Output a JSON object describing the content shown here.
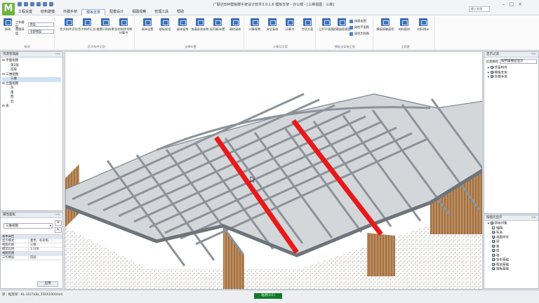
{
  "window": {
    "title": "广联达BIM模板脚手架设计软件3.0.1.6 模板支架 - 办公楼 - [三维视图：三维]",
    "search_box": "键入关键"
  },
  "ribbon_tabs": [
    {
      "label": "工程设置",
      "active": false
    },
    {
      "label": "结构建模",
      "active": false
    },
    {
      "label": "外脚手架",
      "active": false
    },
    {
      "label": "模板支架",
      "active": true
    },
    {
      "label": "配模设计",
      "active": false
    },
    {
      "label": "视图观察",
      "active": false
    },
    {
      "label": "管理工具",
      "active": false
    },
    {
      "label": "帮助",
      "active": false
    }
  ],
  "ribbon": {
    "select_group": {
      "select_label": "修改",
      "work_floor_label": "工作楼层",
      "work_floor_value": "首层",
      "view_depth_label": "视图深度",
      "view_depth_value": "全部楼层",
      "group_label": "修改"
    },
    "identify_group": {
      "buttons": [
        "危大构件识别",
        "危大构件汇总",
        "重置识别结果",
        "危险构件判断计算书"
      ],
      "group_label": "危大构件识别"
    },
    "layout_group": {
      "buttons": [
        "梁体设置",
        "楼板架设",
        "梁体架构",
        "查看梁体参数",
        "配切板布置",
        "清除梁体"
      ],
      "group_label": "支模布置"
    },
    "calc_group": {
      "buttons": [
        "计算参数",
        "安全复核",
        "计算书",
        "专项方案"
      ],
      "group_label": "计算及方案"
    },
    "drawing_group": {
      "buttons": [
        "立杆平面图",
        "创建剖面视图"
      ],
      "small": [
        "剖面出图",
        "梁柱平面图",
        "梁柱大样图"
      ],
      "group_label": "模板支架施工图"
    },
    "material_group": {
      "buttons": [
        "模板接触面积",
        "材料配料",
        "材料统计"
      ],
      "group_label": "工程量"
    }
  },
  "resource_panel": {
    "title": "资源管理器",
    "tree": [
      {
        "label": "平面视图",
        "indent": 0,
        "checked": true,
        "selected": false
      },
      {
        "label": "第2层",
        "indent": 2,
        "checked": false,
        "selected": false
      },
      {
        "label": "首层",
        "indent": 2,
        "checked": false,
        "selected": false
      },
      {
        "label": "三维视图",
        "indent": 0,
        "checked": true,
        "selected": false
      },
      {
        "label": "三维",
        "indent": 2,
        "checked": false,
        "selected": true
      },
      {
        "label": "立面视图",
        "indent": 0,
        "checked": true,
        "selected": false
      },
      {
        "label": "东",
        "indent": 2,
        "checked": false,
        "selected": false
      },
      {
        "label": "南",
        "indent": 2,
        "checked": false,
        "selected": false
      },
      {
        "label": "西",
        "indent": 2,
        "checked": false,
        "selected": false
      },
      {
        "label": "北",
        "indent": 2,
        "checked": false,
        "selected": false
      },
      {
        "label": "表",
        "indent": 0,
        "checked": true,
        "selected": false
      }
    ]
  },
  "properties_panel": {
    "title": "属性面板",
    "type_value": "三维视图",
    "sections": [
      {
        "header": "基本属性",
        "rows": [
          {
            "k": "显示模式",
            "v": "着色、有光照、..."
          },
          {
            "k": "视图名称",
            "v": "三维"
          },
          {
            "k": "模型比例",
            "v": "1:100"
          }
        ]
      },
      {
        "header": "视图范围",
        "rows": [
          {
            "k": "工作楼层",
            "v": "首层"
          }
        ]
      }
    ],
    "apply_button": "应用"
  },
  "display_filter_panel": {
    "title": "显示过滤",
    "rule_label": "过滤规则",
    "rule_value": "按所属楼层显示",
    "items": [
      {
        "label": "项目构件",
        "checked": true
      },
      {
        "label": "模板支架",
        "checked": true
      },
      {
        "label": "外脚手架",
        "checked": true
      }
    ]
  },
  "object_filter_panel": {
    "title": "按图元显示",
    "items": [
      {
        "label": "所有对象",
        "checked": true,
        "indent": 0
      },
      {
        "label": "轴网",
        "checked": false,
        "indent": 1
      },
      {
        "label": "标高",
        "checked": true,
        "indent": 1
      },
      {
        "label": "视图符号",
        "checked": true,
        "indent": 1
      },
      {
        "label": "梁",
        "checked": true,
        "indent": 1
      },
      {
        "label": "板",
        "checked": true,
        "indent": 1
      },
      {
        "label": "柱",
        "checked": true,
        "indent": 1
      },
      {
        "label": "墙",
        "checked": true,
        "indent": 1
      },
      {
        "label": "条形基础",
        "checked": true,
        "indent": 1
      },
      {
        "label": "框架基础",
        "checked": true,
        "indent": 1
      },
      {
        "label": "筏板基础",
        "checked": true,
        "indent": 1
      }
    ]
  },
  "status": {
    "left_text": "梁 : 框架梁 : KL-15(7)(B)_550X1000mm",
    "green_label": "轴测(0/1)"
  },
  "colors": {
    "highlight_beam": "#e8191b",
    "slab": "#d2d5d8",
    "beam": "#8c9399",
    "accent": "#1f4e9a"
  }
}
